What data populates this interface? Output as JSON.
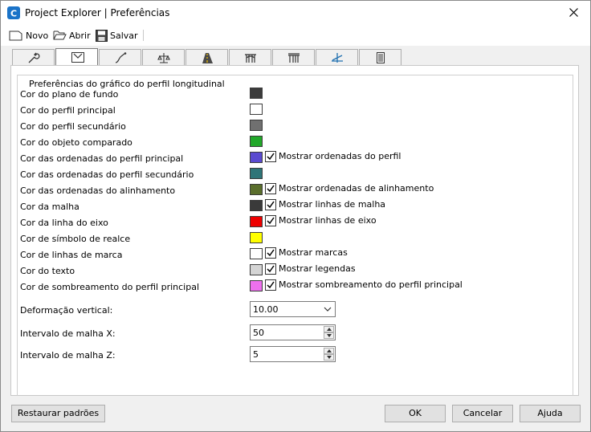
{
  "window": {
    "title": "Project Explorer | Preferências"
  },
  "toolbar": {
    "new_label": "Novo",
    "open_label": "Abrir",
    "save_label": "Salvar"
  },
  "tabs": [
    {
      "icon": "wrench-icon"
    },
    {
      "icon": "profile-window-icon",
      "active": true
    },
    {
      "icon": "curve-icon"
    },
    {
      "icon": "scale-icon"
    },
    {
      "icon": "road-icon"
    },
    {
      "icon": "bridge-icon"
    },
    {
      "icon": "bridge-alt-icon"
    },
    {
      "icon": "superelevation-icon"
    },
    {
      "icon": "report-icon"
    }
  ],
  "group": {
    "title": "Preferências do gráfico do perfil longitudinal"
  },
  "colors": [
    {
      "label": "Cor do plano de fundo",
      "color": "#3c3c3c"
    },
    {
      "label": "Cor do perfil principal",
      "color": "#ffffff"
    },
    {
      "label": "Cor do perfil secundário",
      "color": "#707070"
    },
    {
      "label": "Cor do objeto comparado",
      "color": "#22a82a"
    },
    {
      "label": "Cor das ordenadas do perfil principal",
      "color": "#5a4ad0",
      "checkbox": "Mostrar ordenadas do perfil"
    },
    {
      "label": "Cor das ordenadas do perfil secundário",
      "color": "#2f7578"
    },
    {
      "label": "Cor das ordenadas do alinhamento",
      "color": "#5a6e2c",
      "checkbox": "Mostrar ordenadas de alinhamento"
    },
    {
      "label": "Cor da malha",
      "color": "#3a3a3a",
      "checkbox": "Mostrar linhas de malha"
    },
    {
      "label": "Cor da linha do eixo",
      "color": "#ee0000",
      "checkbox": "Mostrar linhas de eixo"
    },
    {
      "label": "Cor de símbolo de realce",
      "color": "#ffff00"
    },
    {
      "label": "Cor de linhas de marca",
      "color": "#ffffff",
      "checkbox": "Mostrar marcas"
    },
    {
      "label": "Cor do texto",
      "color": "#d4d4d4",
      "checkbox": "Mostrar legendas"
    },
    {
      "label": "Cor de sombreamento do perfil principal",
      "color": "#ee70ee",
      "checkbox": "Mostrar sombreamento do perfil principal"
    }
  ],
  "fields": {
    "vertical_label": "Deformação vertical:",
    "vertical_value": "10.00",
    "grid_x_label": "Intervalo de malha X:",
    "grid_x_value": "50",
    "grid_z_label": "Intervalo de malha Z:",
    "grid_z_value": "5"
  },
  "buttons": {
    "restore": "Restaurar padrões",
    "ok": "OK",
    "cancel": "Cancelar",
    "help": "Ajuda"
  }
}
